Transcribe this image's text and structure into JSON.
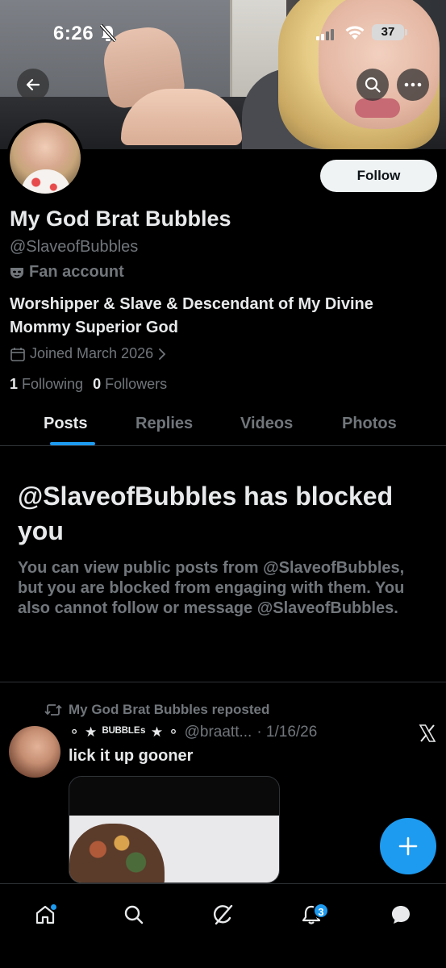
{
  "status_bar": {
    "time": "6:26",
    "battery": "37"
  },
  "profile": {
    "display_name": "My God Brat Bubbles",
    "handle": "@SlaveofBubbles",
    "label": "Fan account",
    "bio": "Worshipper & Slave & Descendant of My Divine Mommy Superior God",
    "joined": "Joined March 2026",
    "following_count": "1",
    "following_label": "Following",
    "followers_count": "0",
    "followers_label": "Followers",
    "follow_button": "Follow"
  },
  "tabs": [
    {
      "label": "Posts",
      "active": true
    },
    {
      "label": "Replies",
      "active": false
    },
    {
      "label": "Videos",
      "active": false
    },
    {
      "label": "Photos",
      "active": false
    }
  ],
  "blocked_notice": {
    "title": "@SlaveofBubbles has blocked you",
    "text": "You can view public posts from @SlaveofBubbles, but you are blocked from engaging with them. You also cannot follow or message @SlaveofBubbles."
  },
  "post": {
    "repost_label": "My God Brat Bubbles reposted",
    "author_name": "ᴮᵁᴮᴮᴸᴱˢ",
    "author_prefix": "⚬ ★",
    "author_suffix": "★ ⚬",
    "author_handle": "@braatt...",
    "date": "· 1/16/26",
    "text": "lick it up gooner"
  },
  "bottom_nav": {
    "notifications_badge": "3"
  },
  "icons": {
    "back": "arrow-left-icon",
    "search": "search-icon",
    "more": "more-horizontal-icon",
    "label": "mask-icon",
    "calendar": "calendar-icon",
    "repost": "repost-icon",
    "x_logo": "x-logo-icon",
    "compose": "plus-icon",
    "home": "home-icon",
    "explore": "search-icon",
    "grok": "grok-icon",
    "notifications": "bell-icon",
    "messages": "message-icon"
  },
  "colors": {
    "accent": "#1d9bf0",
    "background": "#000000",
    "primary_text": "#e7e9ea",
    "secondary_text": "#71767b"
  }
}
